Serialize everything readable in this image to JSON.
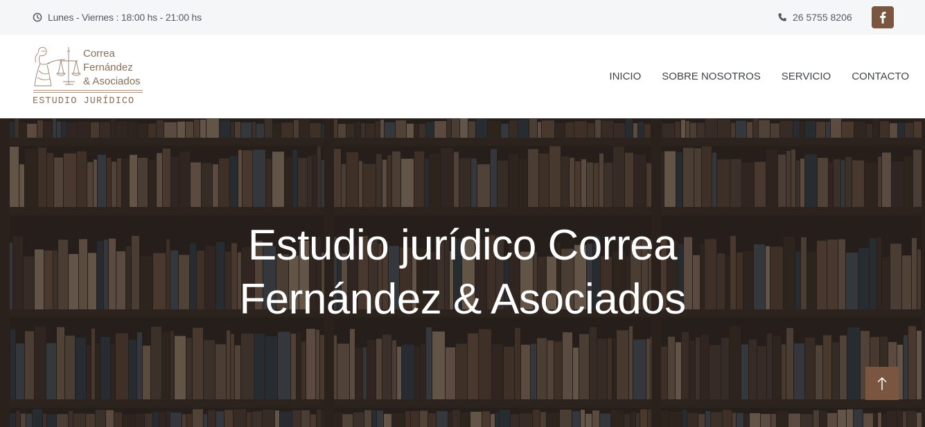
{
  "topbar": {
    "hours_icon": "clock-icon",
    "hours": "Lunes - Viernes : 18:00 hs - 21:00 hs",
    "phone_icon": "phone-icon",
    "phone": "26 5755 8206",
    "social_icon": "facebook-icon"
  },
  "logo": {
    "icon": "lady-justice-icon",
    "line1": "Correa",
    "line2": "Fernández",
    "line3": "& Asociados",
    "subtitle": "ESTUDIO JURÍDICO"
  },
  "nav": {
    "items": [
      {
        "label": "INICIO"
      },
      {
        "label": "SOBRE NOSOTROS"
      },
      {
        "label": "SERVICIO"
      },
      {
        "label": "CONTACTO"
      }
    ]
  },
  "hero": {
    "title_line1": "Estudio jurídico Correa",
    "title_line2": "Fernández & Asociados",
    "background": "bookshelf-photo"
  },
  "scroll_top": {
    "icon": "arrow-up-icon"
  },
  "colors": {
    "accent": "#7a5640",
    "topbar_bg": "#f5f6f8",
    "logo_text": "#8a6e58",
    "nav_text": "#3f4246"
  }
}
